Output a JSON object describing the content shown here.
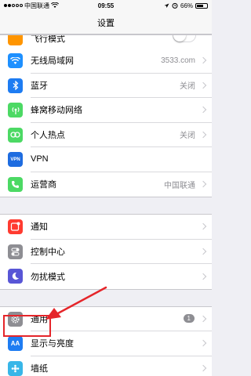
{
  "status": {
    "carrier": "中国联通",
    "time": "09:55",
    "battery": "66%"
  },
  "nav": {
    "title": "设置"
  },
  "rows_group1": [
    {
      "label": "无线局域网",
      "value": "3533.com",
      "icon": "wifi-icon",
      "color": "#1e90ff"
    },
    {
      "label": "蓝牙",
      "value": "关闭",
      "icon": "bluetooth-icon",
      "color": "#1e7cf2"
    },
    {
      "label": "蜂窝移动网络",
      "value": "",
      "icon": "cellular-icon",
      "color": "#4cd964"
    },
    {
      "label": "个人热点",
      "value": "关闭",
      "icon": "hotspot-icon",
      "color": "#4cd964"
    },
    {
      "label": "VPN",
      "value": "",
      "icon": "vpn-icon",
      "color": "#1e6ce0"
    },
    {
      "label": "运营商",
      "value": "中国联通",
      "icon": "phone-icon",
      "color": "#4cd964"
    }
  ],
  "rows_group2": [
    {
      "label": "通知",
      "icon": "notifications-icon",
      "color": "#ff3b30"
    },
    {
      "label": "控制中心",
      "icon": "control-center-icon",
      "color": "#8e8e93"
    },
    {
      "label": "勿扰模式",
      "icon": "moon-icon",
      "color": "#5856d6"
    }
  ],
  "rows_group3": [
    {
      "label": "通用",
      "badge": "1",
      "icon": "gear-icon",
      "color": "#8e8e93"
    },
    {
      "label": "显示与亮度",
      "icon": "display-icon",
      "color": "#1e7cf2"
    },
    {
      "label": "墙纸",
      "icon": "wallpaper-icon",
      "color": "#38b6e8"
    }
  ],
  "accent": "#e5252a",
  "partial_top_label": "飞行模式"
}
